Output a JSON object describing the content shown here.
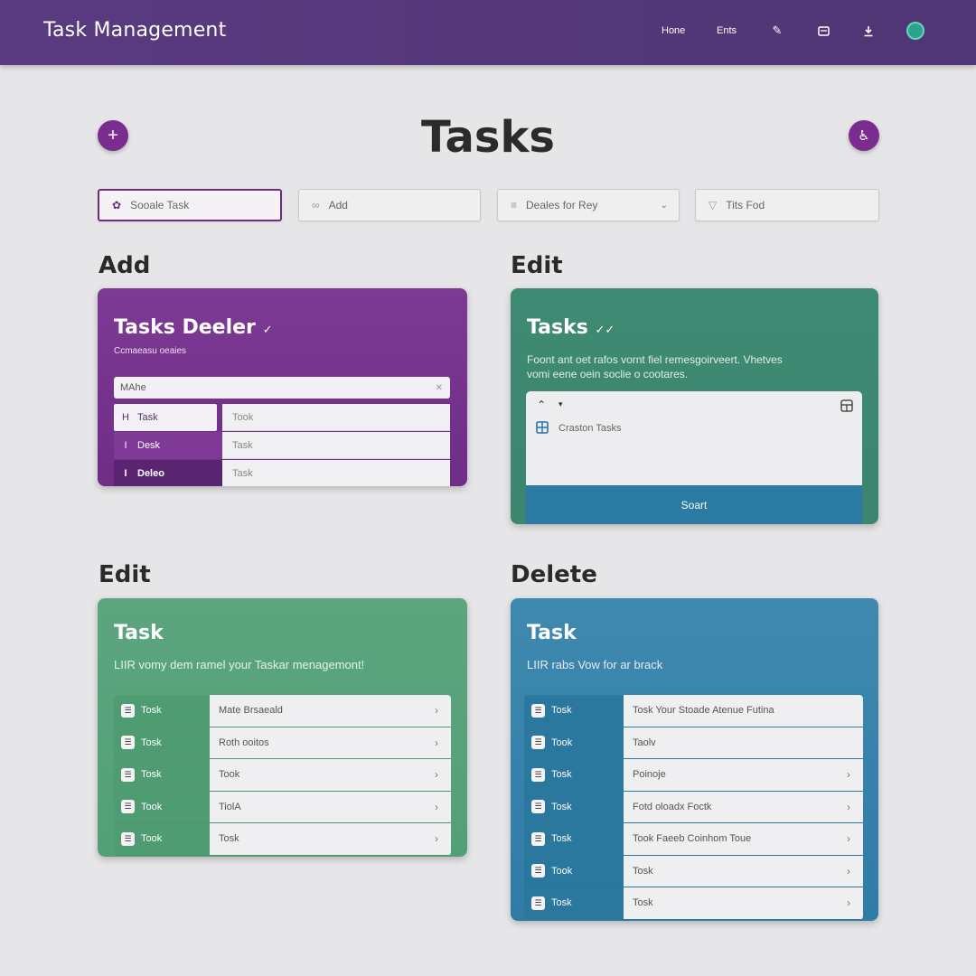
{
  "topbar": {
    "title": "Task Management",
    "links": [
      "Hone",
      "Ents"
    ],
    "icons": [
      "pencil-icon",
      "save-icon",
      "download-icon",
      "avatar"
    ]
  },
  "header": {
    "title": "Tasks",
    "add_icon": "+",
    "right_icon": "&"
  },
  "filters": [
    {
      "label": "Sooale Task",
      "icon": "task-icon"
    },
    {
      "label": "Add",
      "icon": "link-icon"
    },
    {
      "label": "Deales for Rey",
      "icon": "filter-icon"
    },
    {
      "label": "Tits Fod",
      "icon": "sort-icon"
    }
  ],
  "sections": {
    "add": "Add",
    "edit_top": "Edit",
    "edit_bottom": "Edit",
    "delete": "Delete"
  },
  "card_add": {
    "title": "Tasks Deeler",
    "subtitle": "Ccmaeasu oeaies",
    "input_value": "MAhe",
    "side_items": [
      {
        "icon": "H",
        "label": "Task"
      },
      {
        "icon": "I",
        "label": "Desk"
      },
      {
        "icon": "I",
        "label": "Deleo"
      }
    ],
    "main_items": [
      "Took",
      "Task",
      "Task"
    ]
  },
  "card_edit_top": {
    "title": "Tasks",
    "description_line1": "Foont ant oet rafos vornt fiel remesgoirveert. Vhetves",
    "description_line2": "vomi eene oein soclie o cootares.",
    "panel_item": "Craston Tasks",
    "button": "Soart"
  },
  "card_edit_bottom": {
    "title": "Task",
    "description": "LIIR vomy dem ramel your Taskar menagemont!",
    "rows": [
      {
        "side": "Tosk",
        "main": "Mate Brsaeald"
      },
      {
        "side": "Tosk",
        "main": "Roth ooitos"
      },
      {
        "side": "Tosk",
        "main": "Took"
      },
      {
        "side": "Took",
        "main": "TiolA"
      },
      {
        "side": "Took",
        "main": "Tosk"
      }
    ]
  },
  "card_delete": {
    "title": "Task",
    "description": "LIIR rabs Vow for ar brack",
    "rows": [
      {
        "side": "Tosk",
        "main": "Tosk Your Stoade Atenue Futina"
      },
      {
        "side": "Took",
        "main": "Taolv"
      },
      {
        "side": "Tosk",
        "main": "Poinoje"
      },
      {
        "side": "Tosk",
        "main": "Fotd oloadx Foctk"
      },
      {
        "side": "Tosk",
        "main": "Took Faeeb Coinhom Toue"
      },
      {
        "side": "Took",
        "main": "Tosk"
      },
      {
        "side": "Tosk",
        "main": "Tosk"
      }
    ]
  },
  "colors": {
    "topbar": "#5a3a80",
    "purple": "#7d3a94",
    "teal": "#3f8a72",
    "green": "#5ca57f",
    "blue": "#3f89af",
    "button_blue": "#2a7aa2"
  }
}
